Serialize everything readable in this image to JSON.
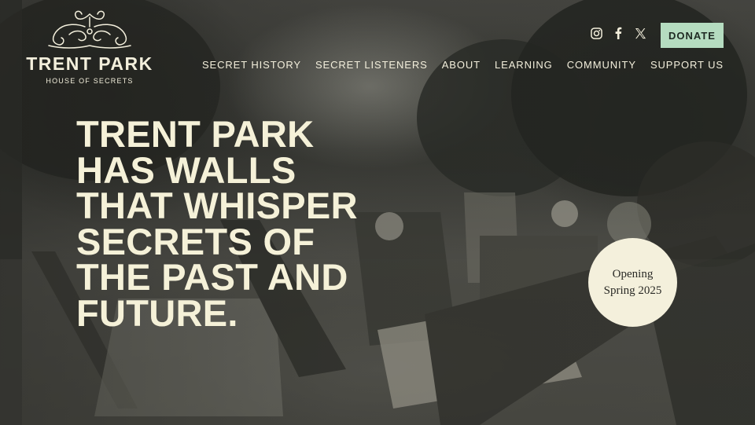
{
  "brand": {
    "title": "TRENT PARK",
    "subtitle": "HOUSE OF SECRETS",
    "logo_icon": "ornamental-scroll-icon"
  },
  "social": [
    {
      "name": "instagram",
      "icon": "instagram-icon"
    },
    {
      "name": "facebook",
      "icon": "facebook-icon"
    },
    {
      "name": "x",
      "icon": "x-twitter-icon"
    }
  ],
  "donate": {
    "label": "DONATE",
    "color": "#b5dcc0"
  },
  "nav": {
    "items": [
      {
        "label": "SECRET HISTORY"
      },
      {
        "label": "SECRET LISTENERS"
      },
      {
        "label": "ABOUT"
      },
      {
        "label": "LEARNING"
      },
      {
        "label": "COMMUNITY"
      },
      {
        "label": "SUPPORT US"
      }
    ]
  },
  "hero": {
    "headline_lines": [
      "TRENT PARK",
      "HAS WALLS",
      "THAT WHISPER",
      "SECRETS OF",
      "THE PAST AND",
      "FUTURE."
    ],
    "badge": {
      "line1": "Opening",
      "line2": "Spring 2025"
    }
  },
  "colors": {
    "text": "#f3efdc",
    "badge_bg": "#f4f0dc",
    "accent": "#b5dcc0"
  }
}
